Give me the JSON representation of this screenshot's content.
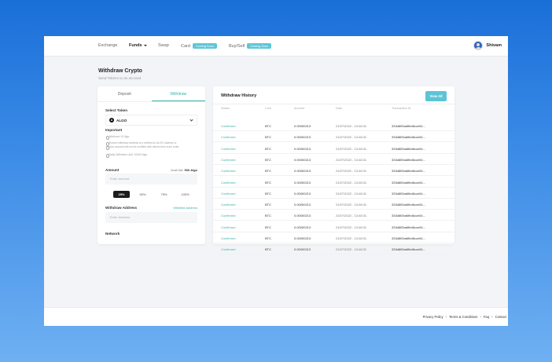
{
  "nav": {
    "items": [
      "Exchange",
      "Funds",
      "Swap",
      "Card",
      "Buy/Sell"
    ],
    "badge_card": "Coming Soon",
    "badge_buysell": "Coming Soon",
    "user_name": "Shivam"
  },
  "page": {
    "title": "Withdraw Crypto",
    "subtitle": "Send Tokens to an account"
  },
  "left": {
    "tabs": [
      "Deposit",
      "Withdraw"
    ],
    "active_tab": "Withdraw",
    "select_token_label": "Select Token",
    "token": "ALGO",
    "important_label": "Important",
    "notes": [
      "Minimum 10 Algo",
      "Ensure withdraw address is a verified on ALGO address or",
      "your account will not be credited with tokens from such order",
      "Daily Withdraw Limit: 10000 Algo"
    ],
    "amount_label": "Amount",
    "avail_prefix": "Avail bal:",
    "avail_value": "500 Algo",
    "amount_placeholder": "Enter amount",
    "percents": [
      "25%",
      "50%",
      "75%",
      "100%"
    ],
    "active_percent": "25%",
    "address_label": "Withdraw Address",
    "whitelist_link": "Whitelist Address",
    "address_placeholder": "Enter Address",
    "network_label": "Network"
  },
  "history": {
    "title": "Withdraw History",
    "view_all": "View All",
    "columns": [
      "Status",
      "Coin",
      "Amount",
      "Date",
      "Transaction ID"
    ],
    "rows": [
      {
        "status": "Confirmed",
        "coin": "BTC",
        "amount": "0.00000213",
        "date": "21/07/2022 - 13:48:31",
        "txid": "333d8f2ba6fbd6cce54..."
      },
      {
        "status": "Confirmed",
        "coin": "BTC",
        "amount": "0.00000213",
        "date": "21/07/2022 - 13:48:31",
        "txid": "333d8f2ba6fbd6cce54..."
      },
      {
        "status": "Confirmed",
        "coin": "BTC",
        "amount": "0.00000213",
        "date": "21/07/2022 - 13:48:31",
        "txid": "333d8f2ba6fbd6cce54..."
      },
      {
        "status": "Confirmed",
        "coin": "BTC",
        "amount": "0.00000213",
        "date": "21/07/2022 - 13:48:31",
        "txid": "333d8f2ba6fbd6cce54..."
      },
      {
        "status": "Confirmed",
        "coin": "BTC",
        "amount": "0.00000213",
        "date": "21/07/2022 - 13:48:31",
        "txid": "333d8f2ba6fbd6cce54..."
      },
      {
        "status": "Confirmed",
        "coin": "BTC",
        "amount": "0.00000213",
        "date": "21/07/2022 - 13:48:31",
        "txid": "333d8f2ba6fbd6cce54..."
      },
      {
        "status": "Confirmed",
        "coin": "BTC",
        "amount": "0.00000213",
        "date": "21/07/2022 - 13:48:31",
        "txid": "333d8f2ba6fbd6cce54..."
      },
      {
        "status": "Confirmed",
        "coin": "BTC",
        "amount": "0.00000213",
        "date": "21/07/2022 - 13:48:31",
        "txid": "333d8f2ba6fbd6cce54..."
      },
      {
        "status": "Confirmed",
        "coin": "BTC",
        "amount": "0.00000213",
        "date": "21/07/2022 - 13:48:31",
        "txid": "333d8f2ba6fbd6cce54..."
      },
      {
        "status": "Confirmed",
        "coin": "BTC",
        "amount": "0.00000213",
        "date": "21/07/2022 - 13:48:31",
        "txid": "333d8f2ba6fbd6cce54..."
      },
      {
        "status": "Confirmed",
        "coin": "BTC",
        "amount": "0.00000213",
        "date": "21/07/2022 - 13:48:31",
        "txid": "333d8f2ba6fbd6cce54..."
      },
      {
        "status": "Confirmed",
        "coin": "BTC",
        "amount": "0.00000213",
        "date": "21/07/2022 - 13:48:31",
        "txid": "333d8f2ba6fbd6cce54..."
      }
    ]
  },
  "footer": {
    "links": [
      "Privacy Policy",
      "Terms & Conditions",
      "Faq",
      "Contact"
    ]
  },
  "colors": {
    "accent": "#3bb3a6",
    "button": "#5cc4d6",
    "background": "#1a6fd8"
  }
}
